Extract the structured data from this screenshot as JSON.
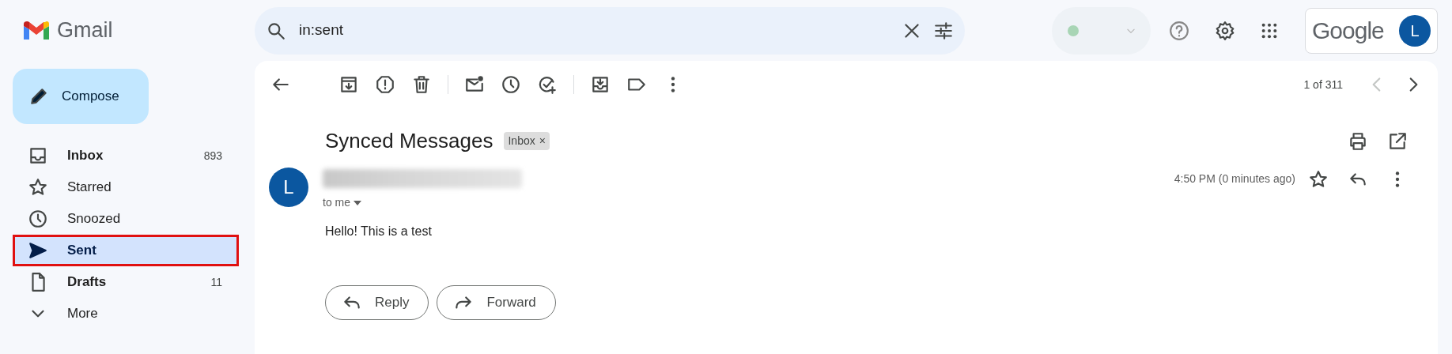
{
  "app": {
    "name": "Gmail"
  },
  "search": {
    "value": "in:sent"
  },
  "status": {
    "color": "#a8d5b5"
  },
  "account": {
    "brand": "Google",
    "avatar_letter": "L"
  },
  "compose": {
    "label": "Compose"
  },
  "sidebar": {
    "items": [
      {
        "label": "Inbox",
        "count": "893",
        "bold": true,
        "selected": false
      },
      {
        "label": "Starred",
        "bold": false,
        "selected": false
      },
      {
        "label": "Snoozed",
        "bold": false,
        "selected": false
      },
      {
        "label": "Sent",
        "bold": true,
        "selected": true
      },
      {
        "label": "Drafts",
        "count": "11",
        "bold": true,
        "selected": false
      },
      {
        "label": "More",
        "bold": false,
        "selected": false
      }
    ]
  },
  "toolbar": {
    "pager": "1 of 311",
    "prev_disabled": true
  },
  "message": {
    "subject": "Synced Messages",
    "label": "Inbox",
    "label_close": "×",
    "avatar_letter": "L",
    "recipient": "to me",
    "time": "4:50 PM (0 minutes ago)",
    "body": "Hello! This is a test",
    "starred": false
  },
  "actions": [
    {
      "label": "Reply"
    },
    {
      "label": "Forward"
    }
  ]
}
